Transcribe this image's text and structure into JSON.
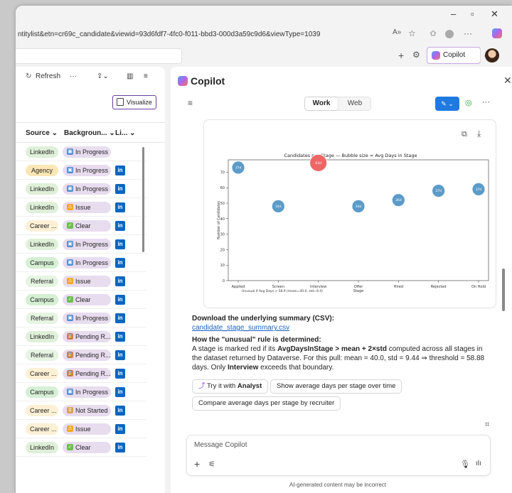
{
  "browser": {
    "url": "ntitylist&etn=cr69c_candidate&viewid=93d6fdf7-4fc0-f011-bbd3-000d3a59c9d6&viewType=1039",
    "copilot_tab_label": "Copilot"
  },
  "grid": {
    "commands": {
      "refresh": "Refresh",
      "more": "···"
    },
    "visualize_label": "Visualize",
    "columns": [
      "Source",
      "Backgroun...",
      "Li..."
    ],
    "rows": [
      {
        "source": "LinkedIn",
        "bg": "In Progress",
        "li": false
      },
      {
        "source": "Agency",
        "bg": "In Progress",
        "li": true
      },
      {
        "source": "LinkedIn",
        "bg": "In Progress",
        "li": true
      },
      {
        "source": "LinkedIn",
        "bg": "Issue",
        "li": true
      },
      {
        "source": "Career ...",
        "bg": "Clear",
        "li": true
      },
      {
        "source": "LinkedIn",
        "bg": "In Progress",
        "li": true
      },
      {
        "source": "Campus",
        "bg": "In Progress",
        "li": true
      },
      {
        "source": "Referral",
        "bg": "Issue",
        "li": true
      },
      {
        "source": "Campus",
        "bg": "Clear",
        "li": true
      },
      {
        "source": "Referral",
        "bg": "In Progress",
        "li": true
      },
      {
        "source": "LinkedIn",
        "bg": "Pending R...",
        "li": true
      },
      {
        "source": "Referral",
        "bg": "Pending R...",
        "li": true
      },
      {
        "source": "Career ...",
        "bg": "Pending R...",
        "li": true
      },
      {
        "source": "Campus",
        "bg": "In Progress",
        "li": true
      },
      {
        "source": "Career ...",
        "bg": "Not Started",
        "li": true
      },
      {
        "source": "Career ...",
        "bg": "Issue",
        "li": true
      },
      {
        "source": "LinkedIn",
        "bg": "Clear",
        "li": true
      }
    ],
    "source_colors": {
      "LinkedIn": "#dff0d8",
      "Agency": "#fbe7b5",
      "Career ...": "#fdf0d5",
      "Campus": "#d5efd3",
      "Referral": "#e6f4e2"
    }
  },
  "copilot": {
    "title": "Copilot",
    "modes": [
      "Work",
      "Web"
    ],
    "active_mode": "Work",
    "download_heading": "Download the underlying summary (CSV):",
    "download_link": "candidate_stage_summary.csv",
    "rule_heading": "How the \"unusual\" rule is determined:",
    "rule_text_1": "A stage is marked red if its ",
    "rule_bold_1": "AvgDaysInStage > mean + 2×std",
    "rule_text_2": " computed across all stages in the dataset returned by Dataverse. For this pull: mean = 40.0, std = 9.44 ⇒ threshold = 58.88 days. Only ",
    "rule_bold_2": "Interview",
    "rule_text_3": " exceeds that boundary.",
    "suggestions": {
      "analyst_prefix": "Try it with ",
      "analyst_bold": "Analyst",
      "s1": "Show average days per stage over time",
      "s2": "Compare average days per stage by recruiter"
    },
    "message_placeholder": "Message Copilot",
    "disclaimer": "AI-generated content may be incorrect"
  },
  "chart_data": {
    "type": "scatter",
    "title": "Candidates per Stage — Bubble size = Avg Days in Stage",
    "xlabel": "Unusual if Avg Days > 58.9 (mean=40.0, std=9.4)",
    "ylabel": "Number of Candidates",
    "categories": [
      "Applied",
      "Screen",
      "Interview",
      "Offer Stage",
      "Hired",
      "Rejected",
      "On Hold"
    ],
    "values": [
      73,
      48,
      76,
      48,
      52,
      58,
      59
    ],
    "bubble_labels": [
      "37d",
      "34d",
      "63d",
      "34d",
      "36d",
      "37d",
      "37d"
    ],
    "unusual": [
      false,
      false,
      true,
      false,
      false,
      false,
      false
    ],
    "ylim": [
      0,
      78
    ],
    "yticks": [
      0,
      10,
      20,
      30,
      40,
      50,
      60,
      70
    ],
    "colors": {
      "normal": "#5b9bc9",
      "unusual": "#ee6666"
    }
  }
}
